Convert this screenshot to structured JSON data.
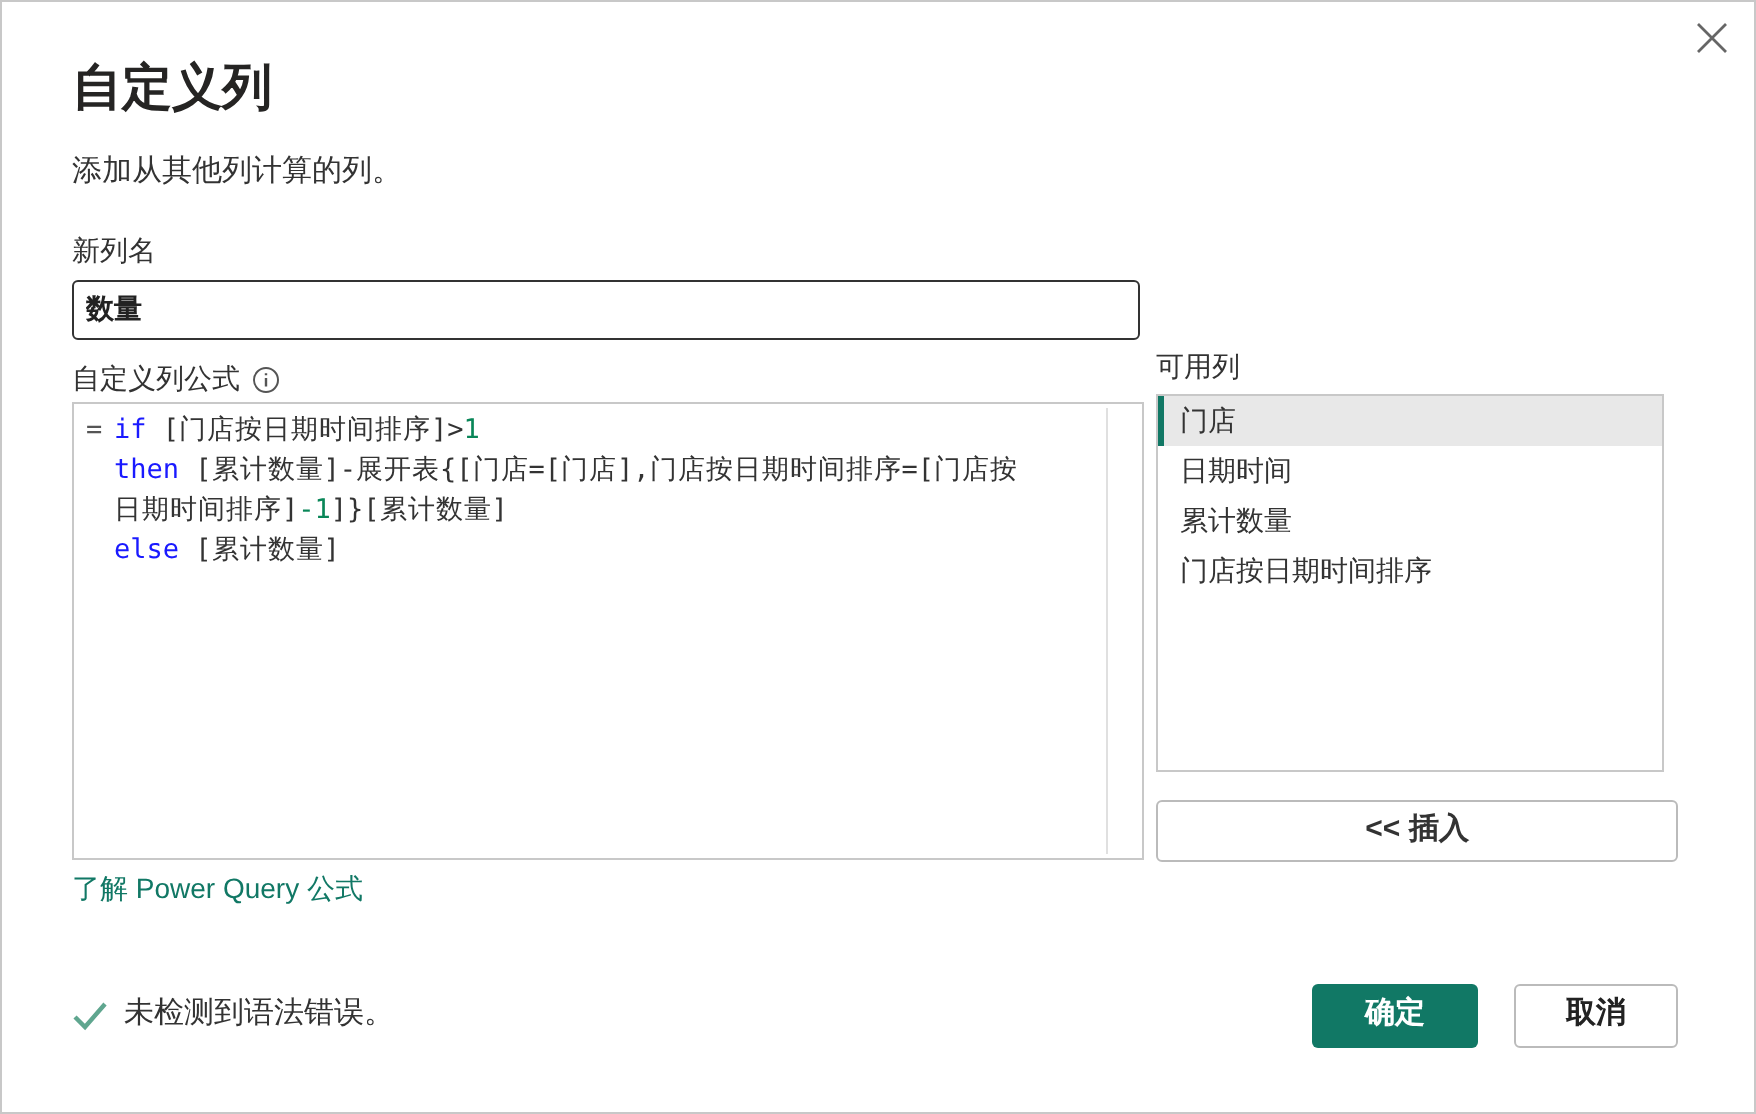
{
  "dialog": {
    "title": "自定义列",
    "subtitle": "添加从其他列计算的列。"
  },
  "new_column": {
    "label": "新列名",
    "value": "数量"
  },
  "formula": {
    "label": "自定义列公式",
    "prefix": "=",
    "lines": [
      [
        {
          "kind": "keyword",
          "text": "if"
        },
        {
          "kind": "text",
          "text": " [门店按日期时间排序]>"
        },
        {
          "kind": "number",
          "text": "1"
        }
      ],
      [
        {
          "kind": "keyword",
          "text": "then"
        },
        {
          "kind": "text",
          "text": " [累计数量]-展开表{[门店=[门店],门店按日期时间排序=[门店按"
        }
      ],
      [
        {
          "kind": "text",
          "text": "日期时间排序]"
        },
        {
          "kind": "number",
          "text": "-1"
        },
        {
          "kind": "text",
          "text": "]}[累计数量]"
        }
      ],
      [
        {
          "kind": "keyword",
          "text": "else"
        },
        {
          "kind": "text",
          "text": " [累计数量]"
        }
      ]
    ]
  },
  "available_columns": {
    "label": "可用列",
    "items": [
      {
        "label": "门店",
        "selected": true
      },
      {
        "label": "日期时间",
        "selected": false
      },
      {
        "label": "累计数量",
        "selected": false
      },
      {
        "label": "门店按日期时间排序",
        "selected": false
      }
    ],
    "insert_button": "<< 插入"
  },
  "learn_link": "了解 Power Query 公式",
  "status": {
    "ok": true,
    "text": "未检测到语法错误。"
  },
  "buttons": [
    {
      "label": "确定",
      "primary": true
    },
    {
      "label": "取消",
      "primary": false
    }
  ]
}
